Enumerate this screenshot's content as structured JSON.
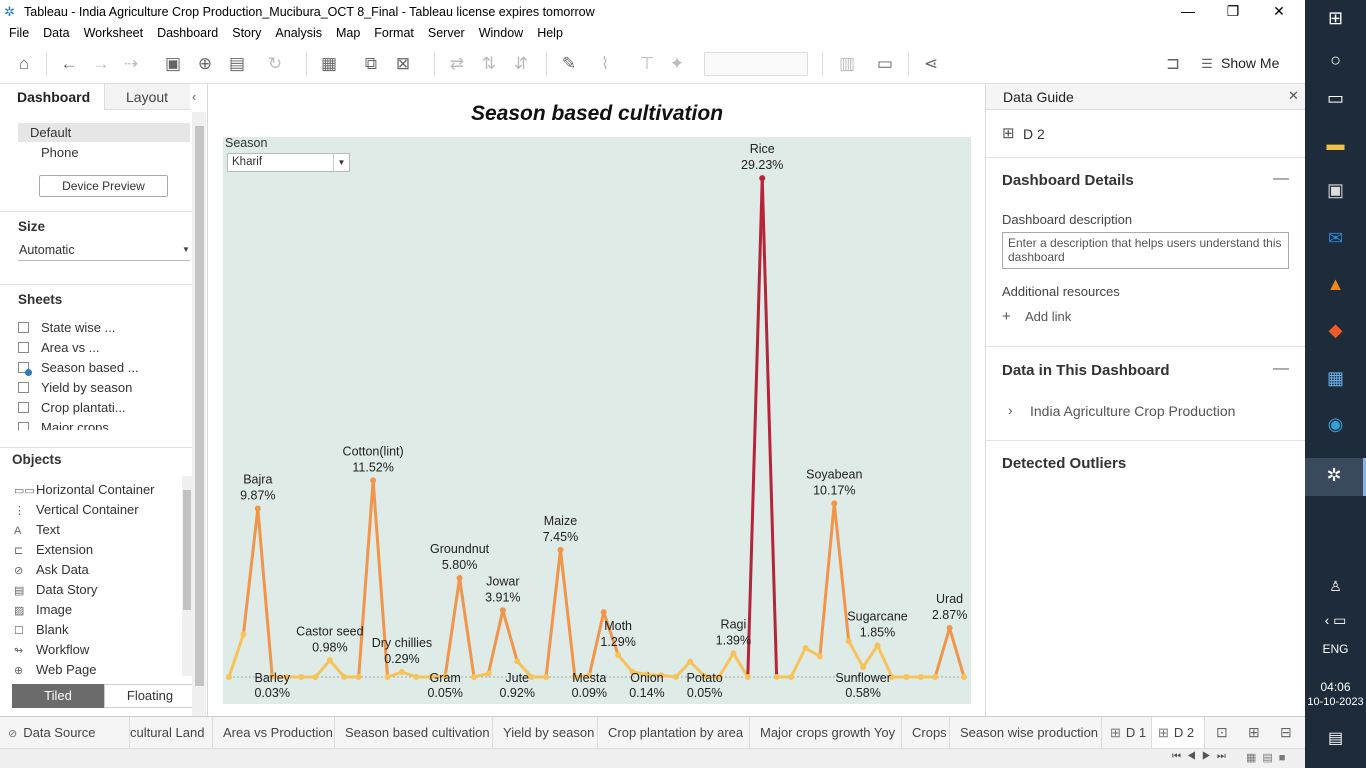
{
  "window": {
    "title": "Tableau - India Agriculture Crop Production_Mucibura_OCT 8_Final - Tableau license expires tomorrow"
  },
  "menu": [
    "File",
    "Data",
    "Worksheet",
    "Dashboard",
    "Story",
    "Analysis",
    "Map",
    "Format",
    "Server",
    "Window",
    "Help"
  ],
  "toolbar": {
    "show_me_label": "Show Me"
  },
  "left_panel": {
    "tab_dashboard": "Dashboard",
    "tab_layout": "Layout",
    "device_default": "Default",
    "device_phone": "Phone",
    "device_preview": "Device Preview",
    "size_title": "Size",
    "size_value": "Automatic",
    "sheets_title": "Sheets",
    "sheets": [
      "State wise ...",
      "Area vs ...",
      "Season based ...",
      "Yield by season",
      "Crop plantati...",
      "Major crops"
    ],
    "objects_title": "Objects",
    "objects": [
      "Horizontal Container",
      "Vertical Container",
      "Text",
      "Extension",
      "Ask Data",
      "Data Story",
      "Image",
      "Blank",
      "Workflow",
      "Web Page"
    ],
    "tiled": "Tiled",
    "floating": "Floating"
  },
  "dashboard": {
    "title": "Season based cultivation",
    "filter_label": "Season",
    "filter_value": "Kharif"
  },
  "chart_data": {
    "type": "line",
    "title": "",
    "ylim": [
      0,
      30
    ],
    "points": [
      0,
      2.5,
      9.87,
      0.03,
      0,
      0,
      0,
      0.98,
      0,
      0,
      11.52,
      0,
      0.29,
      0,
      0,
      0.05,
      5.8,
      0,
      0.2,
      3.91,
      0.92,
      0,
      0,
      7.45,
      0,
      0.09,
      3.8,
      1.29,
      0.3,
      0.14,
      0.1,
      0,
      0.9,
      0.05,
      0,
      1.39,
      0,
      29.23,
      0,
      0,
      1.7,
      1.2,
      10.17,
      2.1,
      0.58,
      1.85,
      0,
      0,
      0,
      0,
      2.87,
      0
    ],
    "labels": [
      {
        "name": "Bajra",
        "value": "9.87%",
        "idx": 2
      },
      {
        "name": "Barley",
        "value": "0.03%",
        "idx": 3,
        "below": true
      },
      {
        "name": "Castor seed",
        "value": "0.98%",
        "idx": 7
      },
      {
        "name": "Cotton(lint)",
        "value": "11.52%",
        "idx": 10
      },
      {
        "name": "Dry chillies",
        "value": "0.29%",
        "idx": 12
      },
      {
        "name": "Gram",
        "value": "0.05%",
        "idx": 15,
        "below": true
      },
      {
        "name": "Groundnut",
        "value": "5.80%",
        "idx": 16
      },
      {
        "name": "Jowar",
        "value": "3.91%",
        "idx": 19
      },
      {
        "name": "Jute",
        "value": "0.92%",
        "idx": 20,
        "below": true
      },
      {
        "name": "Maize",
        "value": "7.45%",
        "idx": 23
      },
      {
        "name": "Mesta",
        "value": "0.09%",
        "idx": 25,
        "below": true
      },
      {
        "name": "Moth",
        "value": "1.29%",
        "idx": 27
      },
      {
        "name": "Onion",
        "value": "0.14%",
        "idx": 29,
        "below": true
      },
      {
        "name": "Potato",
        "value": "0.05%",
        "idx": 33,
        "below": true
      },
      {
        "name": "Ragi",
        "value": "1.39%",
        "idx": 35
      },
      {
        "name": "Rice",
        "value": "29.23%",
        "idx": 37
      },
      {
        "name": "Soyabean",
        "value": "10.17%",
        "idx": 42
      },
      {
        "name": "Sunflower",
        "value": "0.58%",
        "idx": 44,
        "below": true
      },
      {
        "name": "Sugarcane",
        "value": "1.85%",
        "idx": 45
      },
      {
        "name": "Urad",
        "value": "2.87%",
        "idx": 50
      }
    ],
    "colors": {
      "low": "#f6c35b",
      "mid": "#f0954a",
      "high": "#b6243a"
    }
  },
  "right_panel": {
    "title": "Data Guide",
    "sheet_name": "D 2",
    "details_title": "Dashboard Details",
    "description_label": "Dashboard description",
    "description_placeholder": "Enter a description that helps users understand this dashboard",
    "additional_resources": "Additional resources",
    "add_link": "Add link",
    "data_title": "Data in This Dashboard",
    "data_source": "India Agriculture Crop Production",
    "outliers_title": "Detected Outliers"
  },
  "bottom_tabs": [
    "Data Source",
    "cultural Land",
    "Area vs Production",
    "Season based cultivation",
    "Yield by season",
    "Crop plantation by area",
    "Major crops growth Yoy",
    "Crops",
    "Season wise production",
    "D 1",
    "D 2"
  ],
  "taskbar": {
    "time": "04:06",
    "date": "10-10-2023",
    "lang": "ENG"
  }
}
